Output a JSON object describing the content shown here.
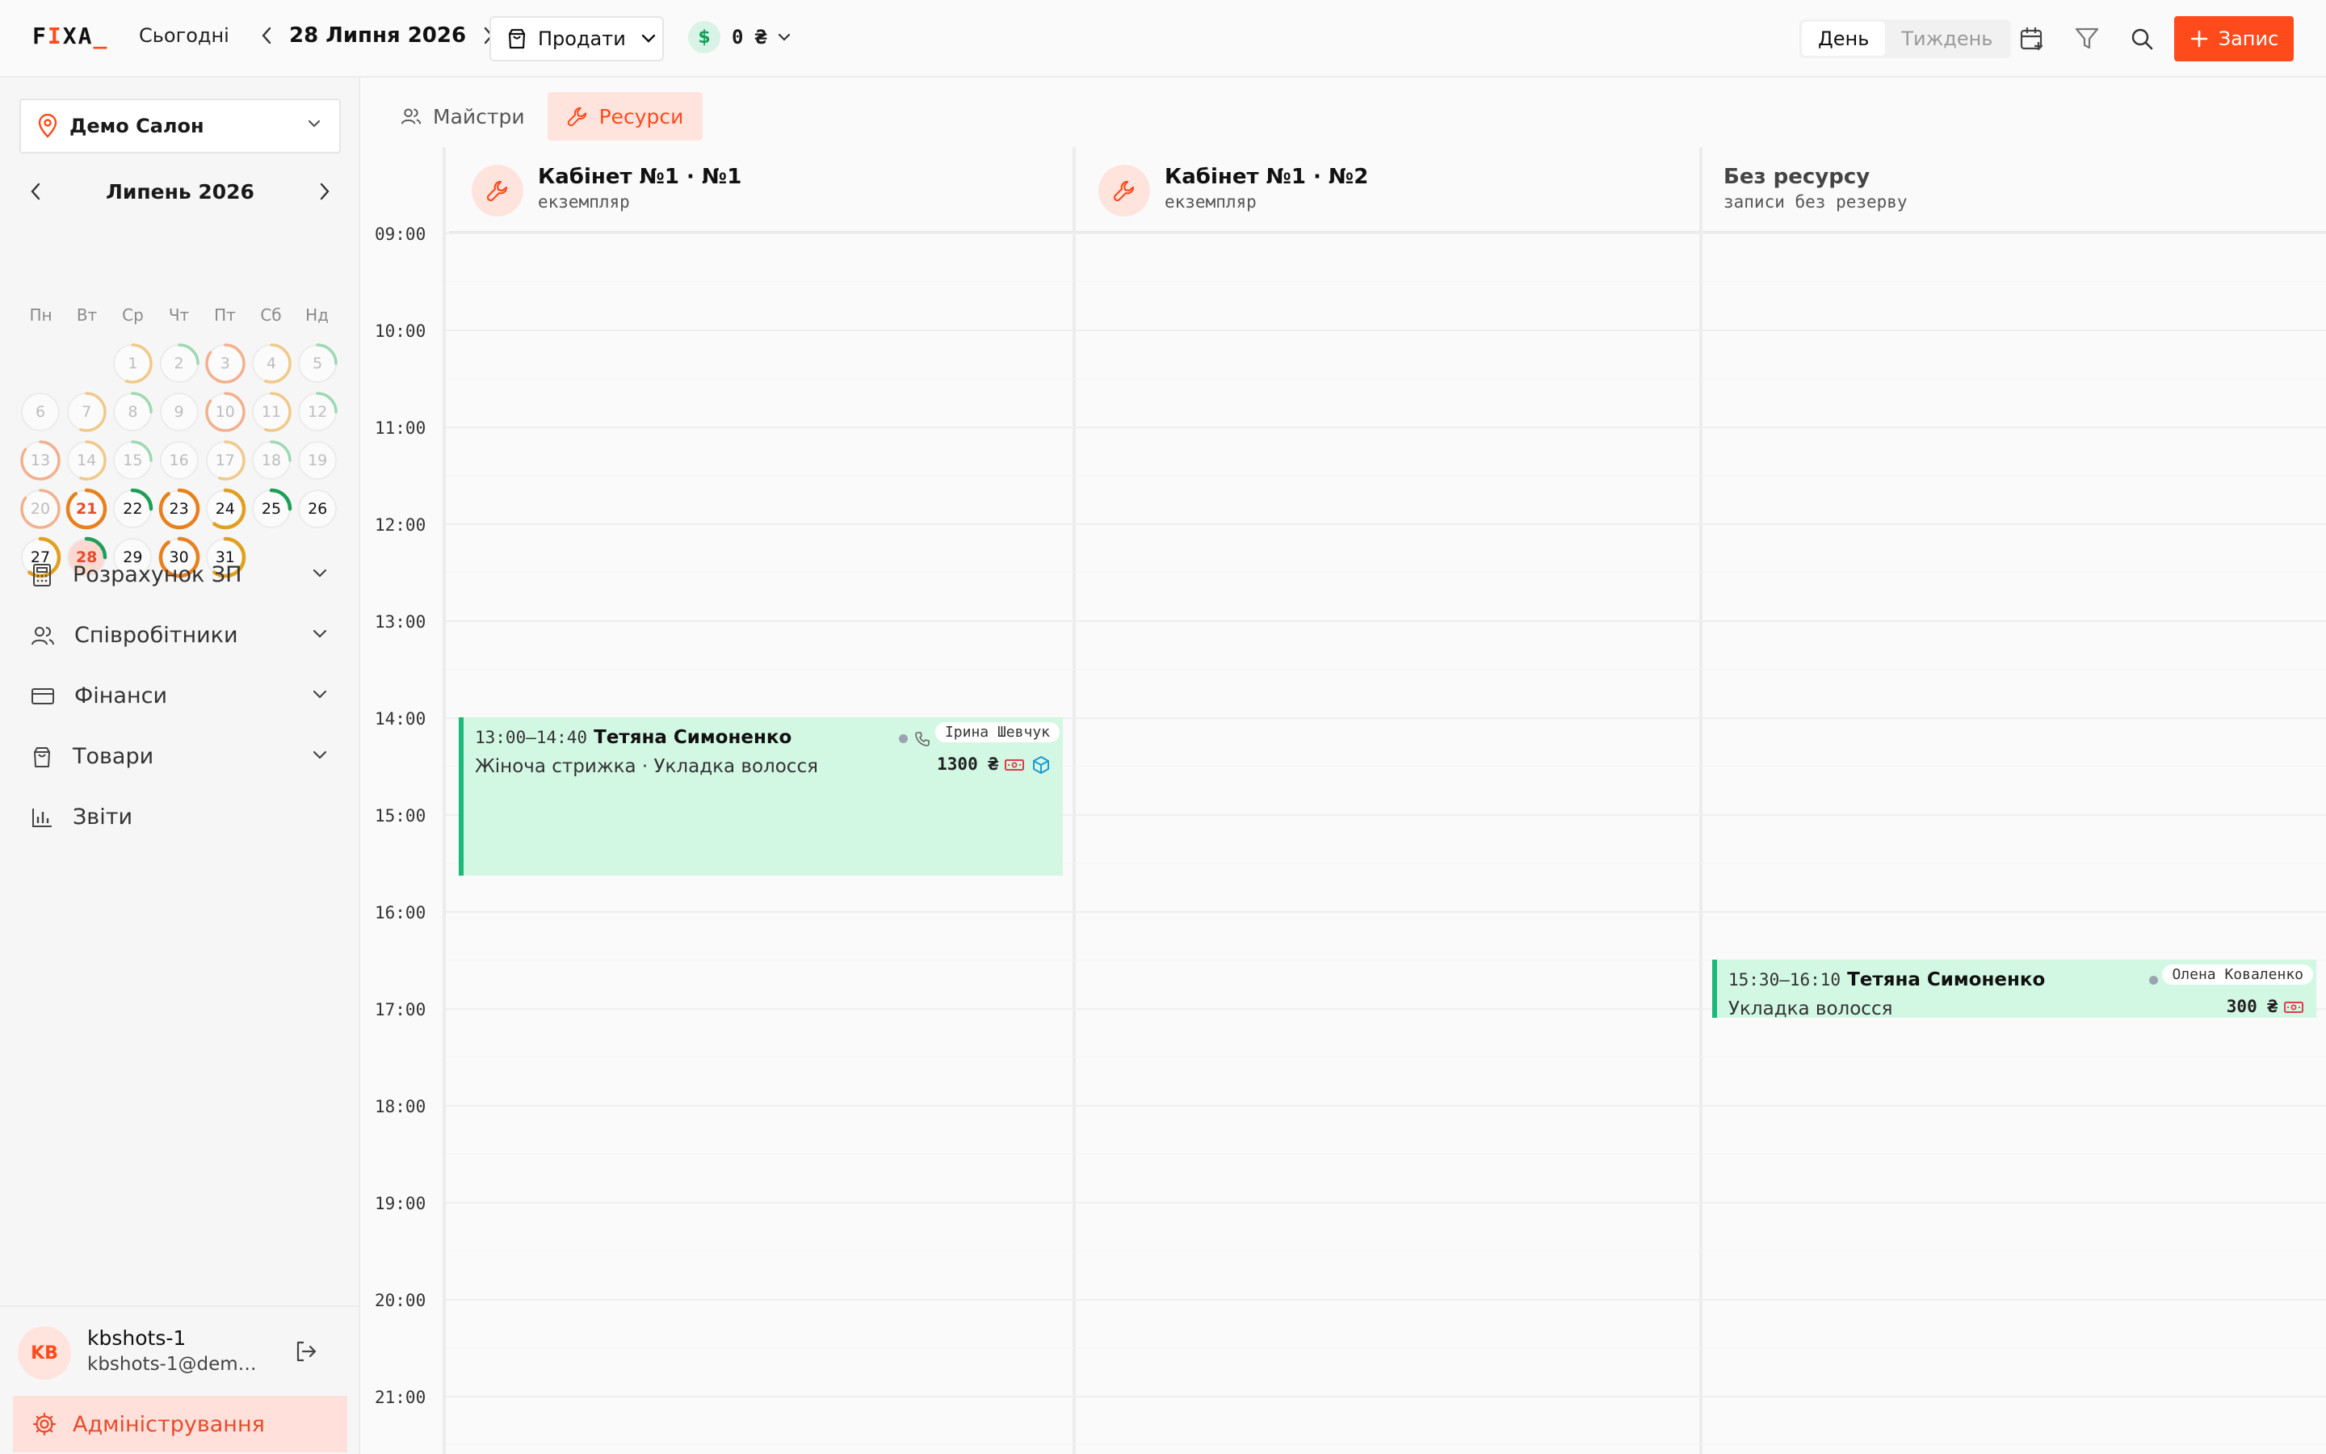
{
  "app": {
    "logo_main": "FIXA",
    "logo_cursor": "_"
  },
  "header": {
    "today_label": "Сьогодні",
    "date_label": "28 Липня 2026",
    "sell_label": "Продати",
    "cash_symbol": "$",
    "cash_amount": "0 ₴",
    "view_day": "День",
    "view_week": "Тиждень",
    "add_label": "Запис",
    "colors": {
      "accent": "#ff4a1c",
      "success": "#14a05a"
    }
  },
  "sidebar": {
    "salon_name": "Демо Салон",
    "calendar": {
      "month_label": "Липень 2026",
      "weekdays": [
        "Пн",
        "Вт",
        "Ср",
        "Чт",
        "Пт",
        "Сб",
        "Нд"
      ],
      "selected_day": 28,
      "today_day": 21,
      "days": [
        {
          "d": 1,
          "load": 0.55,
          "color": "#f1c98a",
          "past": true
        },
        {
          "d": 2,
          "load": 0.25,
          "color": "#9ed8b4",
          "past": true
        },
        {
          "d": 3,
          "load": 0.85,
          "color": "#f3b08e",
          "past": true
        },
        {
          "d": 4,
          "load": 0.55,
          "color": "#f1c98a",
          "past": true
        },
        {
          "d": 5,
          "load": 0.25,
          "color": "#9ed8b4",
          "past": true
        },
        {
          "d": 6,
          "load": 0,
          "color": "#e9e9e9",
          "past": true
        },
        {
          "d": 7,
          "load": 0.55,
          "color": "#f1c98a",
          "past": true
        },
        {
          "d": 8,
          "load": 0.25,
          "color": "#9ed8b4",
          "past": true
        },
        {
          "d": 9,
          "load": 0,
          "color": "#e9e9e9",
          "past": true
        },
        {
          "d": 10,
          "load": 0.85,
          "color": "#f3b08e",
          "past": true
        },
        {
          "d": 11,
          "load": 0.55,
          "color": "#f1c98a",
          "past": true
        },
        {
          "d": 12,
          "load": 0.25,
          "color": "#9ed8b4",
          "past": true
        },
        {
          "d": 13,
          "load": 0.85,
          "color": "#f3b08e",
          "past": true
        },
        {
          "d": 14,
          "load": 0.55,
          "color": "#f1c98a",
          "past": true
        },
        {
          "d": 15,
          "load": 0.25,
          "color": "#9ed8b4",
          "past": true
        },
        {
          "d": 16,
          "load": 0,
          "color": "#e9e9e9",
          "past": true
        },
        {
          "d": 17,
          "load": 0.55,
          "color": "#f1c98a",
          "past": true
        },
        {
          "d": 18,
          "load": 0.25,
          "color": "#9ed8b4",
          "past": true
        },
        {
          "d": 19,
          "load": 0,
          "color": "#e9e9e9",
          "past": true
        },
        {
          "d": 20,
          "load": 0.85,
          "color": "#f3b08e",
          "past": true
        },
        {
          "d": 21,
          "load": 0.9,
          "color": "#e8801e",
          "past": false
        },
        {
          "d": 22,
          "load": 0.25,
          "color": "#1e9e56",
          "past": false
        },
        {
          "d": 23,
          "load": 0.9,
          "color": "#e8801e",
          "past": false
        },
        {
          "d": 24,
          "load": 0.6,
          "color": "#e0a020",
          "past": false
        },
        {
          "d": 25,
          "load": 0.25,
          "color": "#1e9e56",
          "past": false
        },
        {
          "d": 26,
          "load": 0,
          "color": "#e4e4e4",
          "past": false
        },
        {
          "d": 27,
          "load": 0.6,
          "color": "#e0a020",
          "past": false
        },
        {
          "d": 28,
          "load": 0.25,
          "color": "#1e9e56",
          "past": false
        },
        {
          "d": 29,
          "load": 0,
          "color": "#e4e4e4",
          "past": false
        },
        {
          "d": 30,
          "load": 0.9,
          "color": "#e8801e",
          "past": false
        },
        {
          "d": 31,
          "load": 0.6,
          "color": "#e0a020",
          "past": false
        }
      ]
    },
    "menu": [
      {
        "label": "Розрахунок ЗП",
        "icon": "calculator-icon",
        "expandable": true
      },
      {
        "label": "Співробітники",
        "icon": "users-icon",
        "expandable": true
      },
      {
        "label": "Фінанси",
        "icon": "credit-card-icon",
        "expandable": true
      },
      {
        "label": "Товари",
        "icon": "shopping-bag-icon",
        "expandable": true
      },
      {
        "label": "Звіти",
        "icon": "bar-chart-icon",
        "expandable": false
      }
    ],
    "user": {
      "initials": "KB",
      "name": "kbshots-1",
      "email": "kbshots-1@demo..."
    },
    "admin_label": "Адміністрування"
  },
  "main": {
    "tabs": [
      {
        "label": "Майстри",
        "icon": "users-icon",
        "active": false
      },
      {
        "label": "Ресурси",
        "icon": "wrench-icon",
        "active": true
      }
    ],
    "columns": [
      {
        "name": "Кабінет №1 · №1",
        "sub": "екземпляр",
        "icon": "wrench-icon"
      },
      {
        "name": "Кабінет №1 · №2",
        "sub": "екземпляр",
        "icon": "wrench-icon"
      },
      {
        "name": "Без ресурсу",
        "sub": "записи без резерву",
        "icon": ""
      }
    ],
    "hours": [
      "09:00",
      "10:00",
      "11:00",
      "12:00",
      "13:00",
      "14:00",
      "15:00",
      "16:00",
      "17:00",
      "18:00",
      "19:00",
      "20:00",
      "21:00"
    ],
    "appointments": [
      {
        "column": 0,
        "time": "13:00–14:40",
        "client": "Тетяна Симоненко",
        "service": "Жіноча стрижка · Укладка волосся",
        "price": "1300 ₴",
        "master": "Ірина Шевчук",
        "icons": [
          "phone-icon",
          "cash-icon",
          "box-icon"
        ]
      },
      {
        "column": 2,
        "time": "15:30–16:10",
        "client": "Тетяна Симоненко",
        "service": "Укладка волосся",
        "price": "300 ₴",
        "master": "Олена Коваленко",
        "icons": [
          "cash-icon"
        ]
      }
    ]
  }
}
